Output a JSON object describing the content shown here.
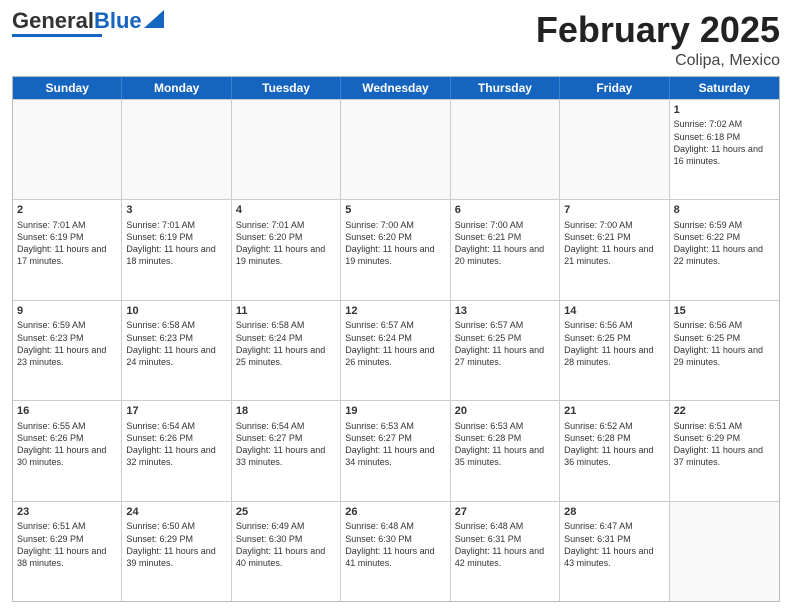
{
  "logo": {
    "text_general": "General",
    "text_blue": "Blue"
  },
  "header": {
    "month_year": "February 2025",
    "location": "Colipa, Mexico"
  },
  "days": [
    "Sunday",
    "Monday",
    "Tuesday",
    "Wednesday",
    "Thursday",
    "Friday",
    "Saturday"
  ],
  "weeks": [
    [
      {
        "day": "",
        "empty": true
      },
      {
        "day": "",
        "empty": true
      },
      {
        "day": "",
        "empty": true
      },
      {
        "day": "",
        "empty": true
      },
      {
        "day": "",
        "empty": true
      },
      {
        "day": "",
        "empty": true
      },
      {
        "day": "1",
        "sunrise": "7:02 AM",
        "sunset": "6:18 PM",
        "daylight": "11 hours and 16 minutes."
      }
    ],
    [
      {
        "day": "2",
        "sunrise": "7:01 AM",
        "sunset": "6:19 PM",
        "daylight": "11 hours and 17 minutes."
      },
      {
        "day": "3",
        "sunrise": "7:01 AM",
        "sunset": "6:19 PM",
        "daylight": "11 hours and 18 minutes."
      },
      {
        "day": "4",
        "sunrise": "7:01 AM",
        "sunset": "6:20 PM",
        "daylight": "11 hours and 19 minutes."
      },
      {
        "day": "5",
        "sunrise": "7:00 AM",
        "sunset": "6:20 PM",
        "daylight": "11 hours and 19 minutes."
      },
      {
        "day": "6",
        "sunrise": "7:00 AM",
        "sunset": "6:21 PM",
        "daylight": "11 hours and 20 minutes."
      },
      {
        "day": "7",
        "sunrise": "7:00 AM",
        "sunset": "6:21 PM",
        "daylight": "11 hours and 21 minutes."
      },
      {
        "day": "8",
        "sunrise": "6:59 AM",
        "sunset": "6:22 PM",
        "daylight": "11 hours and 22 minutes."
      }
    ],
    [
      {
        "day": "9",
        "sunrise": "6:59 AM",
        "sunset": "6:23 PM",
        "daylight": "11 hours and 23 minutes."
      },
      {
        "day": "10",
        "sunrise": "6:58 AM",
        "sunset": "6:23 PM",
        "daylight": "11 hours and 24 minutes."
      },
      {
        "day": "11",
        "sunrise": "6:58 AM",
        "sunset": "6:24 PM",
        "daylight": "11 hours and 25 minutes."
      },
      {
        "day": "12",
        "sunrise": "6:57 AM",
        "sunset": "6:24 PM",
        "daylight": "11 hours and 26 minutes."
      },
      {
        "day": "13",
        "sunrise": "6:57 AM",
        "sunset": "6:25 PM",
        "daylight": "11 hours and 27 minutes."
      },
      {
        "day": "14",
        "sunrise": "6:56 AM",
        "sunset": "6:25 PM",
        "daylight": "11 hours and 28 minutes."
      },
      {
        "day": "15",
        "sunrise": "6:56 AM",
        "sunset": "6:25 PM",
        "daylight": "11 hours and 29 minutes."
      }
    ],
    [
      {
        "day": "16",
        "sunrise": "6:55 AM",
        "sunset": "6:26 PM",
        "daylight": "11 hours and 30 minutes."
      },
      {
        "day": "17",
        "sunrise": "6:54 AM",
        "sunset": "6:26 PM",
        "daylight": "11 hours and 32 minutes."
      },
      {
        "day": "18",
        "sunrise": "6:54 AM",
        "sunset": "6:27 PM",
        "daylight": "11 hours and 33 minutes."
      },
      {
        "day": "19",
        "sunrise": "6:53 AM",
        "sunset": "6:27 PM",
        "daylight": "11 hours and 34 minutes."
      },
      {
        "day": "20",
        "sunrise": "6:53 AM",
        "sunset": "6:28 PM",
        "daylight": "11 hours and 35 minutes."
      },
      {
        "day": "21",
        "sunrise": "6:52 AM",
        "sunset": "6:28 PM",
        "daylight": "11 hours and 36 minutes."
      },
      {
        "day": "22",
        "sunrise": "6:51 AM",
        "sunset": "6:29 PM",
        "daylight": "11 hours and 37 minutes."
      }
    ],
    [
      {
        "day": "23",
        "sunrise": "6:51 AM",
        "sunset": "6:29 PM",
        "daylight": "11 hours and 38 minutes."
      },
      {
        "day": "24",
        "sunrise": "6:50 AM",
        "sunset": "6:29 PM",
        "daylight": "11 hours and 39 minutes."
      },
      {
        "day": "25",
        "sunrise": "6:49 AM",
        "sunset": "6:30 PM",
        "daylight": "11 hours and 40 minutes."
      },
      {
        "day": "26",
        "sunrise": "6:48 AM",
        "sunset": "6:30 PM",
        "daylight": "11 hours and 41 minutes."
      },
      {
        "day": "27",
        "sunrise": "6:48 AM",
        "sunset": "6:31 PM",
        "daylight": "11 hours and 42 minutes."
      },
      {
        "day": "28",
        "sunrise": "6:47 AM",
        "sunset": "6:31 PM",
        "daylight": "11 hours and 43 minutes."
      },
      {
        "day": "",
        "empty": true
      }
    ]
  ]
}
